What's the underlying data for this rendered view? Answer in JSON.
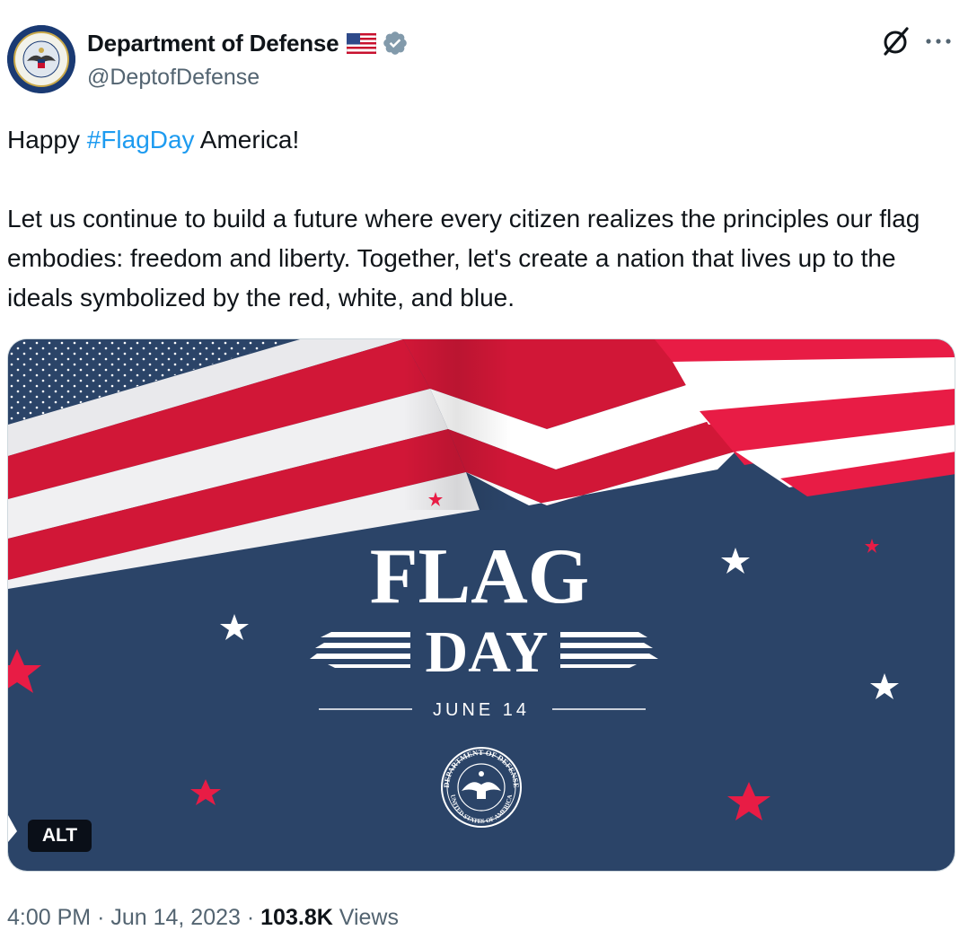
{
  "author": {
    "display_name": "Department of Defense",
    "handle": "@DeptofDefense",
    "flag_emoji_icon": "us-flag-emoji-icon",
    "verified_icon": "verified-badge-icon",
    "verified_color": "#829aab"
  },
  "header_actions": {
    "grok_icon": "grok-icon",
    "more_icon": "more-dots-icon"
  },
  "tweet": {
    "line1_prefix": "Happy ",
    "hashtag": "#FlagDay",
    "line1_suffix": " America!",
    "paragraph2": "Let us continue to build a future where every citizen realizes the principles our flag embodies: freedom and liberty. Together, let's create a nation that lives up to the ideals symbolized by the red, white, and blue."
  },
  "media": {
    "title_line1": "FLAG",
    "title_line2": "DAY",
    "date": "JUNE 14",
    "seal_text_top": "DEPARTMENT OF DEFENSE",
    "seal_text_bottom": "UNITED STATES OF AMERICA",
    "alt_label": "ALT",
    "colors": {
      "navy": "#2b4468",
      "red": "#d8173a",
      "white": "#ffffff"
    }
  },
  "meta": {
    "time": "4:00 PM",
    "separator": "·",
    "date": "Jun 14, 2023",
    "views_count": "103.8K",
    "views_label": "Views"
  },
  "colors": {
    "text_primary": "#0f1419",
    "text_secondary": "#536471",
    "link": "#1d9bf0"
  }
}
